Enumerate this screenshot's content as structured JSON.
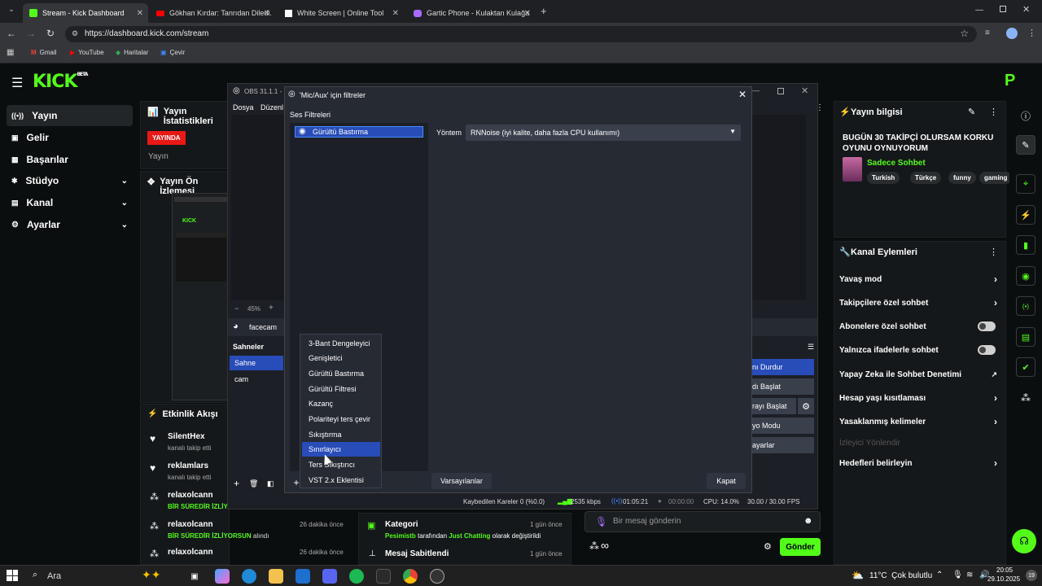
{
  "browser": {
    "tabs": [
      {
        "title": "Stream - Kick Dashboard",
        "active": true
      },
      {
        "title": "Gökhan Kırdar: Tanrıdan Diledi...",
        "active": false
      },
      {
        "title": "White Screen | Online Tool",
        "active": false
      },
      {
        "title": "Gartic Phone - Kulaktan Kulağa",
        "active": false
      }
    ],
    "url": "https://dashboard.kick.com/stream",
    "bookmarks": [
      "Gmail",
      "YouTube",
      "Haritalar",
      "Çevir"
    ]
  },
  "kick": {
    "logo": "KICK",
    "logo_sup": "BETA",
    "sidebar": [
      {
        "label": "Yayın",
        "active": true,
        "chevron": false
      },
      {
        "label": "Gelir",
        "active": false,
        "chevron": false
      },
      {
        "label": "Başarılar",
        "active": false,
        "chevron": false
      },
      {
        "label": "Stüdyo",
        "active": false,
        "chevron": true
      },
      {
        "label": "Kanal",
        "active": false,
        "chevron": true
      },
      {
        "label": "Ayarlar",
        "active": false,
        "chevron": true
      }
    ],
    "stats": {
      "title": "Yayın İstatistikleri",
      "badge": "YAYINDA",
      "sub": "Yayın"
    },
    "preview": {
      "title": "Yayın Ön İzlemesi"
    },
    "feed": {
      "title": "Etkinlik Akışı",
      "items": [
        {
          "name": "SilentHex",
          "sub": "kanalı takip etti",
          "time": ""
        },
        {
          "name": "reklamlars",
          "sub": "kanalı takip etti",
          "time": ""
        },
        {
          "name": "relaxolcann",
          "sub": "BİR SÜREDİR İZLİYO...",
          "time": ""
        },
        {
          "name": "relaxolcann",
          "sub": "BİR SÜREDİR İZLİYORSUN",
          "sub2": " alındı",
          "time": "26 dakika önce"
        },
        {
          "name": "relaxolcann",
          "sub": "",
          "time": "26 dakika önce"
        }
      ]
    },
    "category": {
      "title": "Kategori",
      "time": "1 gün önce",
      "who": "Pesimistb",
      "text1": " tarafından ",
      "cat": "Just Chatting",
      "text2": " olarak değiştirildi"
    },
    "pinned": {
      "title": "Mesaj Sabitlendi",
      "time": "1 gün önce"
    },
    "chat": {
      "placeholder": "Bir mesaj gönderin",
      "send": "Gönder",
      "infinity": "∞"
    },
    "stream_info": {
      "title": "Yayın bilgisi",
      "stream_title": "BUGÜN 30 TAKİPÇİ OLURSAM KORKU OYUNU OYNUYORUM",
      "category": "Sadece Sohbet",
      "tags": [
        "Turkish",
        "Türkçe",
        "funny",
        "gaming"
      ]
    },
    "channel_actions": {
      "title": "Kanal Eylemleri",
      "items": [
        {
          "label": "Yavaş mod",
          "type": "arrow"
        },
        {
          "label": "Takipçilere özel sohbet",
          "type": "arrow"
        },
        {
          "label": "Abonelere özel sohbet",
          "type": "toggle"
        },
        {
          "label": "Yalnızca ifadelerle sohbet",
          "type": "toggle"
        },
        {
          "label": "Yapay Zeka ile Sohbet Denetimi",
          "type": "external"
        },
        {
          "label": "Hesap yaşı kısıtlaması",
          "type": "arrow"
        },
        {
          "label": "Yasaklanmış kelimeler",
          "type": "arrow"
        },
        {
          "label": "İzleyici Yönlendir",
          "type": "disabled"
        },
        {
          "label": "Hedefleri belirleyin",
          "type": "arrow"
        }
      ]
    }
  },
  "obs": {
    "window_title": "OBS 31.1.1 - P",
    "menu": [
      "Dosya",
      "Düzenl"
    ],
    "zoom": "45%",
    "source": "facecam",
    "scenes_title": "Sahneler",
    "scenes": [
      "Sahne",
      "cam"
    ],
    "controls": [
      "nı Durdur",
      "dı Başlat",
      "rayı Başlat",
      "yo Modu",
      "ayarlar"
    ],
    "status": {
      "dropped": "Kaybedilen Kareler 0 (%0.0)",
      "kbps": "2535 kbps",
      "live": "01:05:21",
      "rec": "00:00:00",
      "cpu": "CPU: 14.0%",
      "fps": "30.00 / 30.00 FPS"
    }
  },
  "dialog": {
    "title": "'Mic/Aux' için filtreler",
    "section": "Ses Filtreleri",
    "filter": "Gürültü Bastırma",
    "method_label": "Yöntem",
    "method_value": "RNNoise (iyi kalite, daha fazla CPU kullanımı)",
    "defaults": "Varsayılanlar",
    "close": "Kapat",
    "menu": [
      "3-Bant Dengeleyici",
      "Genişletici",
      "Gürültü Bastırma",
      "Gürültü Filtresi",
      "Kazanç",
      "Polariteyi ters çevir",
      "Sıkıştırma",
      "Sınırlayıcı",
      "Ters Sıkıştırıcı",
      "VST 2.x Eklentisi"
    ],
    "menu_selected": "Sınırlayıcı"
  },
  "taskbar": {
    "search": "Ara",
    "weather": "11°C  Çok bulutlu",
    "time": "20:05",
    "date": "29.10.2025"
  },
  "colors": {
    "kick_green": "#53fc18",
    "live_red": "#e91916",
    "obs_select": "#284cb8"
  }
}
